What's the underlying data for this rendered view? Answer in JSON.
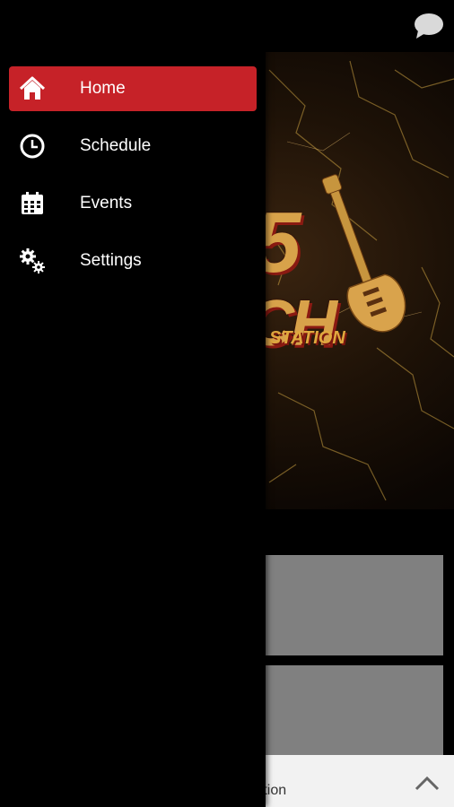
{
  "menu": {
    "items": [
      {
        "label": "Home",
        "icon": "home-icon",
        "active": true
      },
      {
        "label": "Schedule",
        "icon": "clock-icon",
        "active": false
      },
      {
        "label": "Events",
        "icon": "calendar-icon",
        "active": false
      },
      {
        "label": "Settings",
        "icon": "gears-icon",
        "active": false
      }
    ]
  },
  "hero": {
    "logo_number": "5",
    "logo_letters": "CH",
    "logo_subtitle": "STATION"
  },
  "player": {
    "now_playing": "ock Station"
  },
  "colors": {
    "accent": "#c62228",
    "drawer_bg": "#000000",
    "card_bg": "#808080",
    "logo_gold": "#d8a24a"
  }
}
